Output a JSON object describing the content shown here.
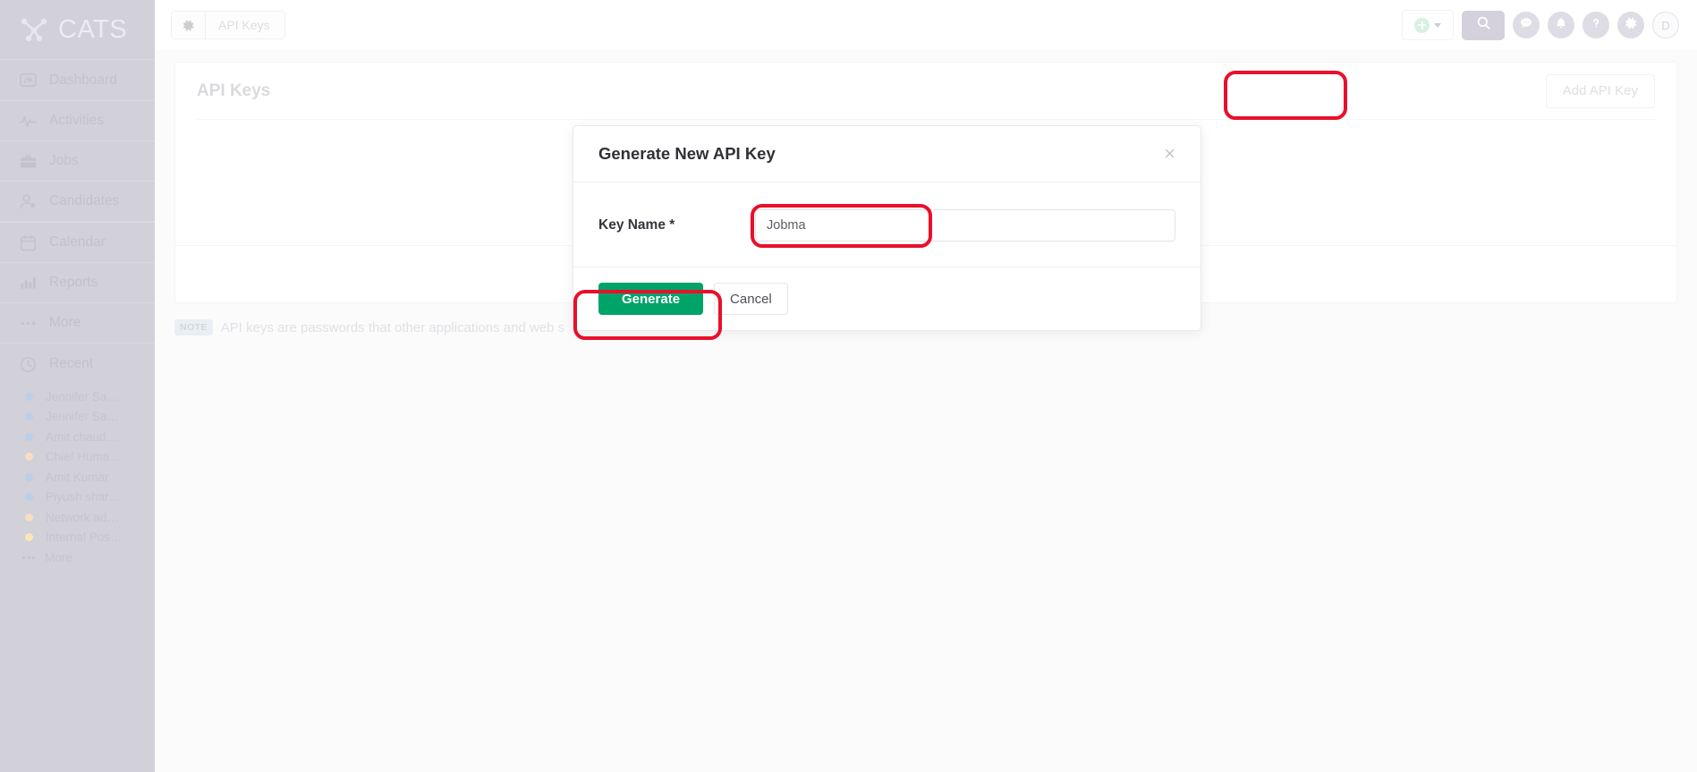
{
  "brand": {
    "name": "CATS"
  },
  "sidebar": {
    "nav": [
      {
        "label": "Dashboard",
        "icon": "dashboard-icon"
      },
      {
        "label": "Activities",
        "icon": "activities-icon"
      },
      {
        "label": "Jobs",
        "icon": "briefcase-icon"
      },
      {
        "label": "Candidates",
        "icon": "candidates-icon"
      },
      {
        "label": "Calendar",
        "icon": "calendar-icon"
      },
      {
        "label": "Reports",
        "icon": "reports-icon"
      },
      {
        "label": "More",
        "icon": "ellipsis-icon"
      }
    ],
    "recent": {
      "label": "Recent",
      "icon": "clock-icon",
      "items": [
        {
          "label": "Jennifer Sa…",
          "color": "#b9cfea"
        },
        {
          "label": "Jennifer Sa…",
          "color": "#b9cfea"
        },
        {
          "label": "Amit chaud…",
          "color": "#b9cfea"
        },
        {
          "label": "Chief Huma…",
          "color": "#f8ddc2"
        },
        {
          "label": "Amit Kumar",
          "color": "#b9cfea"
        },
        {
          "label": "Piyush shar…",
          "color": "#b9cfea"
        },
        {
          "label": "Network ad…",
          "color": "#f8ddc2"
        },
        {
          "label": "Internal Pos…",
          "color": "#fae7b8"
        }
      ],
      "more_label": "More"
    }
  },
  "topbar": {
    "breadcrumb": {
      "icon": "gear-icon",
      "label": "API Keys"
    },
    "actions": [
      {
        "name": "add-button",
        "icon": "plus-circle-icon"
      },
      {
        "name": "search-button",
        "icon": "search-icon"
      },
      {
        "name": "messages-button",
        "icon": "chat-icon"
      },
      {
        "name": "alerts-button",
        "icon": "bell-icon"
      },
      {
        "name": "help-button",
        "icon": "question-icon"
      },
      {
        "name": "settings-button",
        "icon": "gear-icon"
      }
    ],
    "avatar_initial": "D"
  },
  "main": {
    "page_title": "API Keys",
    "add_api_key_label": "Add API Key",
    "note_badge": "NOTE",
    "note_text": "API keys are passwords that other applications and web s"
  },
  "modal": {
    "title": "Generate New API Key",
    "close_label": "×",
    "field_label": "Key Name *",
    "field_value": "Jobma",
    "generate_label": "Generate",
    "cancel_label": "Cancel"
  },
  "annotations": {
    "accent_color": "#e8102a",
    "highlights": [
      "add-api-key-button",
      "key-name-input",
      "generate-button"
    ]
  },
  "theme": {
    "sidebar_bg": "#d2d0d8",
    "primary_green": "#00a368",
    "annotation_red": "#e8102a"
  }
}
